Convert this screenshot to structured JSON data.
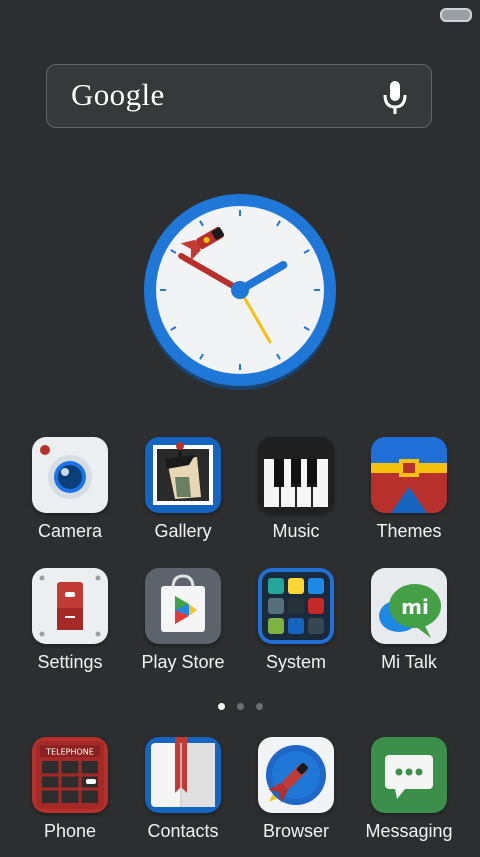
{
  "search": {
    "brand": "Google"
  },
  "clock": {
    "hour_hand_angle_deg": 60,
    "minute_hand_angle_deg": 300,
    "second_hand_angle_deg": 150
  },
  "apps_row1": [
    {
      "label": "Camera",
      "icon": "camera-icon"
    },
    {
      "label": "Gallery",
      "icon": "gallery-icon"
    },
    {
      "label": "Music",
      "icon": "music-icon"
    },
    {
      "label": "Themes",
      "icon": "themes-icon"
    }
  ],
  "apps_row2": [
    {
      "label": "Settings",
      "icon": "settings-icon"
    },
    {
      "label": "Play Store",
      "icon": "play-store-icon"
    },
    {
      "label": "System",
      "icon": "system-folder-icon"
    },
    {
      "label": "Mi Talk",
      "icon": "mi-talk-icon"
    }
  ],
  "dock": [
    {
      "label": "Phone",
      "icon": "phone-booth-icon",
      "icon_text": "TELEPHONE"
    },
    {
      "label": "Contacts",
      "icon": "contacts-book-icon"
    },
    {
      "label": "Browser",
      "icon": "browser-rocket-icon"
    },
    {
      "label": "Messaging",
      "icon": "message-bubble-icon"
    }
  ],
  "mi_talk": {
    "bubble_text": "mi"
  },
  "pager": {
    "pages": 3,
    "current": 1
  },
  "colors": {
    "background": "#2c2e30",
    "clock_ring": "#1f77d8",
    "accent_red": "#b8302c",
    "accent_blue": "#1565c0"
  }
}
